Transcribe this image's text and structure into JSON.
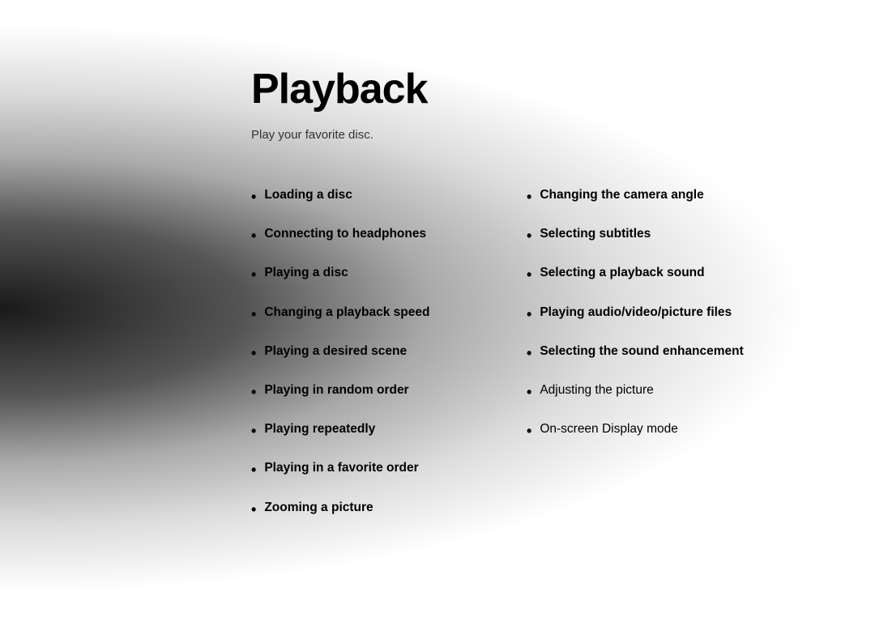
{
  "page": {
    "title": "Playback",
    "subtitle": "Play your favorite disc.",
    "left_items": [
      {
        "label": "Loading a disc",
        "bold": true
      },
      {
        "label": "Connecting to headphones",
        "bold": true
      },
      {
        "label": "Playing a disc",
        "bold": true
      },
      {
        "label": "Changing a playback speed",
        "bold": true
      },
      {
        "label": "Playing a desired scene",
        "bold": true
      },
      {
        "label": "Playing in random order",
        "bold": true
      },
      {
        "label": "Playing repeatedly",
        "bold": true
      },
      {
        "label": "Playing in a favorite order",
        "bold": true
      },
      {
        "label": "Zooming a picture",
        "bold": true
      }
    ],
    "right_items": [
      {
        "label": "Changing the camera angle",
        "bold": true
      },
      {
        "label": "Selecting subtitles",
        "bold": true
      },
      {
        "label": "Selecting a playback sound",
        "bold": true
      },
      {
        "label": "Playing audio/video/picture files",
        "bold": true
      },
      {
        "label": "Selecting the sound enhancement",
        "bold": true
      },
      {
        "label": "Adjusting the picture",
        "bold": false
      },
      {
        "label": "On-screen Display mode",
        "bold": false
      }
    ]
  }
}
